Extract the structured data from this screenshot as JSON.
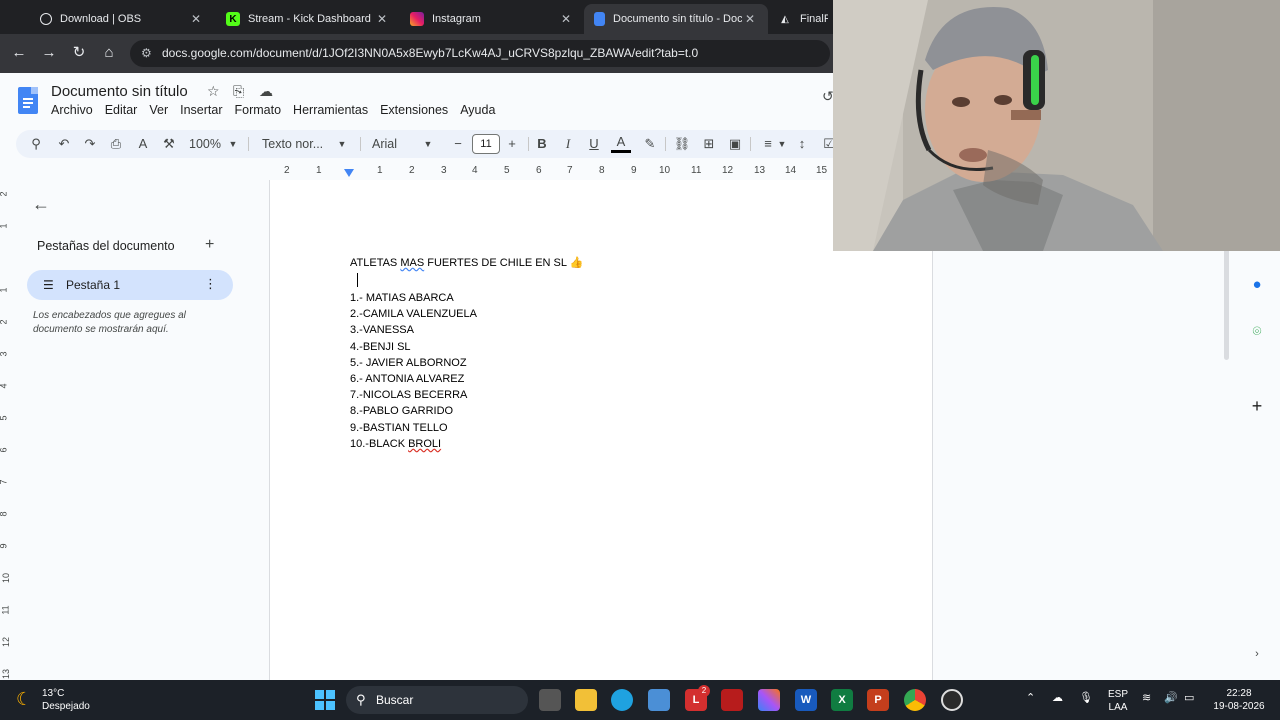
{
  "browser": {
    "tabs": [
      {
        "title": "Download | OBS",
        "icon": "obs-icon",
        "active": false
      },
      {
        "title": "Stream - Kick Dashboard",
        "icon": "kick-icon",
        "active": false
      },
      {
        "title": "Instagram",
        "icon": "instagram-icon",
        "active": false
      },
      {
        "title": "Documento sin título - Docu",
        "icon": "docs-icon",
        "active": true
      },
      {
        "title": "FinalRep",
        "icon": "finalrep-icon",
        "active": false
      }
    ],
    "url": "docs.google.com/document/d/1JOf2I3NN0A5x8Ewyb7LcKw4AJ_uCRVS8pzlqu_ZBAWA/edit?tab=t.0"
  },
  "docs": {
    "title": "Documento sin título",
    "menu": [
      "Archivo",
      "Editar",
      "Ver",
      "Insertar",
      "Formato",
      "Herramientas",
      "Extensiones",
      "Ayuda"
    ],
    "toolbar": {
      "zoom": "100%",
      "style": "Texto nor...",
      "font": "Arial",
      "font_size": "11"
    },
    "ruler_ticks": [
      "2",
      "1",
      "1",
      "2",
      "3",
      "4",
      "5",
      "6",
      "7",
      "8",
      "9",
      "10",
      "11",
      "12",
      "13",
      "14",
      "15"
    ],
    "vruler_ticks": [
      "2",
      "1",
      "1",
      "2",
      "3",
      "4",
      "5",
      "6",
      "7",
      "8",
      "9",
      "10",
      "11",
      "12",
      "13"
    ],
    "sidebar": {
      "heading": "Pestañas del documento",
      "tab_label": "Pestaña 1",
      "hint": "Los encabezados que agregues al documento se mostrarán aquí."
    },
    "content": {
      "title_pre": "ATLETAS ",
      "title_mas": "MAS",
      "title_post": " FUERTES DE CHILE EN SL ",
      "title_emoji": "👍",
      "items": [
        "1.- MATIAS ABARCA",
        "2.-CAMILA VALENZUELA",
        "3.-VANESSA",
        "4.-BENJI SL",
        "5.- JAVIER ALBORNOZ",
        "6.- ANTONIA ALVAREZ",
        "7.-NICOLAS BECERRA",
        "8.-PABLO GARRIDO",
        "9.-BASTIAN TELLO"
      ],
      "last_item_pre": "10.-BLACK ",
      "last_item_underlined": "BROLI"
    }
  },
  "taskbar": {
    "weather_temp": "13°C",
    "weather_desc": "Despejado",
    "search_placeholder": "Buscar",
    "lang_top": "ESP",
    "lang_bottom": "LAA",
    "time": "22:28",
    "date": "19-08-2026",
    "badge_count": "2"
  }
}
